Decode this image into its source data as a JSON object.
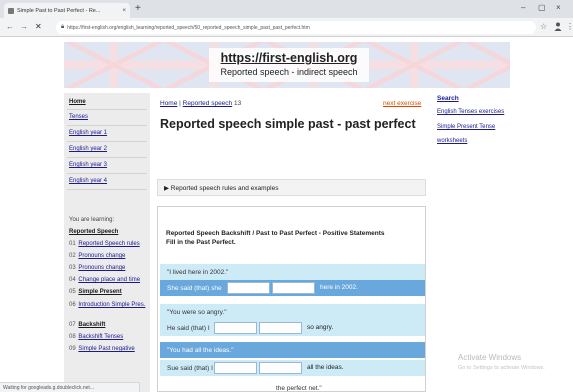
{
  "browser": {
    "tab_title": "Simple Past to Past Perfect - Re...",
    "tab_close": "×",
    "new_tab": "+",
    "minimize": "–",
    "restore": "▢",
    "close": "×",
    "back": "←",
    "forward": "→",
    "reload": "✕",
    "url": "https://first-english.org/english_learning/reported_speech/50_reported_speech_simple_past_past_perfect.htm",
    "star": "☆",
    "menu": "⋮",
    "status": "Waiting for googleads.g.doubleclick.net..."
  },
  "header": {
    "site_url": "https://first-english.org",
    "subtitle": "Reported speech - indirect speech"
  },
  "sidebar": {
    "nav": [
      {
        "label": "Home",
        "bold": true
      },
      {
        "label": "Tenses",
        "bold": false
      },
      {
        "label": "English year 1",
        "bold": false
      },
      {
        "label": "English year 2",
        "bold": false
      },
      {
        "label": "English year 3",
        "bold": false
      },
      {
        "label": "English year 4",
        "bold": false
      }
    ],
    "learning_label": "You are learning:",
    "section_title": "Reported Speech",
    "lessons": [
      {
        "num": "01",
        "label": "Reported Speech rules",
        "strong": false
      },
      {
        "num": "02",
        "label": "Pronouns change",
        "strong": false
      },
      {
        "num": "03",
        "label": "Pronouns change",
        "strong": false
      },
      {
        "num": "04",
        "label": "Change place and time",
        "strong": false
      },
      {
        "num": "05",
        "label": "Simple Present",
        "strong": true
      },
      {
        "num": "06",
        "label": "Introduction Simple Pres.",
        "strong": false
      },
      {
        "num": "07",
        "label": "Backshift",
        "strong": true
      },
      {
        "num": "08",
        "label": "Backshift Tenses",
        "strong": false
      },
      {
        "num": "09",
        "label": "Simple Past negative",
        "strong": false
      }
    ]
  },
  "main": {
    "breadcrumb_home": "Home",
    "breadcrumb_sep": " | ",
    "breadcrumb_section": "Reported speech",
    "breadcrumb_num": " 13",
    "next_exercise": "next exercise",
    "title": "Reported speech simple past - past perfect",
    "rules_label": "▶ Reported speech rules and examples",
    "exercise_heading": "Reported Speech Backshift / Past to Past Perfect - Positive Statements",
    "exercise_instruction": "Fill in the Past Perfect.",
    "questions": [
      {
        "quote": "\"I lived here in 2002.\"",
        "prefix": "She said (that) she",
        "suffix": "here in 2002."
      },
      {
        "quote": "\"You were so angry.\"",
        "prefix": "He said (that) I",
        "suffix": "so angry."
      },
      {
        "quote": "\"You had all the ideas.\"",
        "prefix": "Sue said (that) I",
        "suffix": "all the ideas."
      }
    ],
    "partial_text": "the perfect net.\""
  },
  "right": {
    "search": "Search",
    "links": [
      "English Tenses exercises",
      "Simple Present Tense",
      "worksheets"
    ]
  },
  "overlay": {
    "activate_title": "Activate Windows",
    "activate_sub": "Go to Settings to activate Windows."
  },
  "colors": {
    "band_dark": "#68a8dd",
    "band_light": "#cdeaf7",
    "next_link": "#e04a00",
    "link": "#1a1a8c"
  }
}
